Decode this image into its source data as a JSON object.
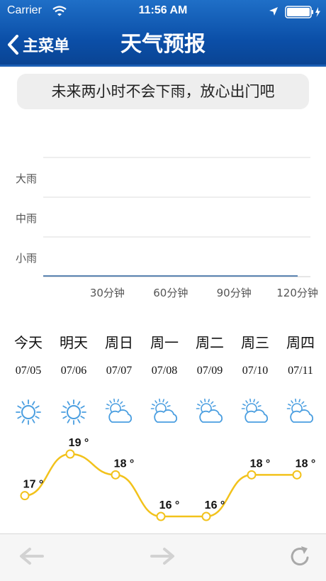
{
  "status_bar": {
    "carrier": "Carrier",
    "time": "11:56 AM"
  },
  "nav": {
    "back_label": "主菜单",
    "title": "天气预报"
  },
  "notice": "未来两小时不会下雨，放心出门吧",
  "colors": {
    "header": "#0b4fa8",
    "temp_curve": "#f2c21b",
    "icon": "#4a9ee0",
    "rain_line": "#5b84b1"
  },
  "chart_data": [
    {
      "type": "line",
      "title": "",
      "x": [
        0,
        120
      ],
      "y": [
        0,
        0
      ],
      "xlim": [
        0,
        120
      ],
      "xticks": [
        30,
        60,
        90,
        120
      ],
      "xtick_labels": [
        "30分钟",
        "60分钟",
        "90分钟",
        "120分钟"
      ],
      "ylevels": [
        "小雨",
        "中雨",
        "大雨"
      ],
      "grid": true
    },
    {
      "type": "line",
      "categories": [
        "今天",
        "明天",
        "周日",
        "周一",
        "周二",
        "周三",
        "周四"
      ],
      "dates": [
        "07/05",
        "07/06",
        "07/07",
        "07/08",
        "07/09",
        "07/10",
        "07/11"
      ],
      "icons": [
        "sun-icon",
        "sun-icon",
        "partly-cloudy-icon",
        "partly-cloudy-icon",
        "partly-cloudy-icon",
        "partly-cloudy-icon",
        "partly-cloudy-icon"
      ],
      "values": [
        17,
        19,
        18,
        16,
        16,
        18,
        18
      ],
      "value_labels": [
        "17 °",
        "19 °",
        "18 °",
        "16 °",
        "16 °",
        "18 °",
        "18 °"
      ]
    }
  ]
}
